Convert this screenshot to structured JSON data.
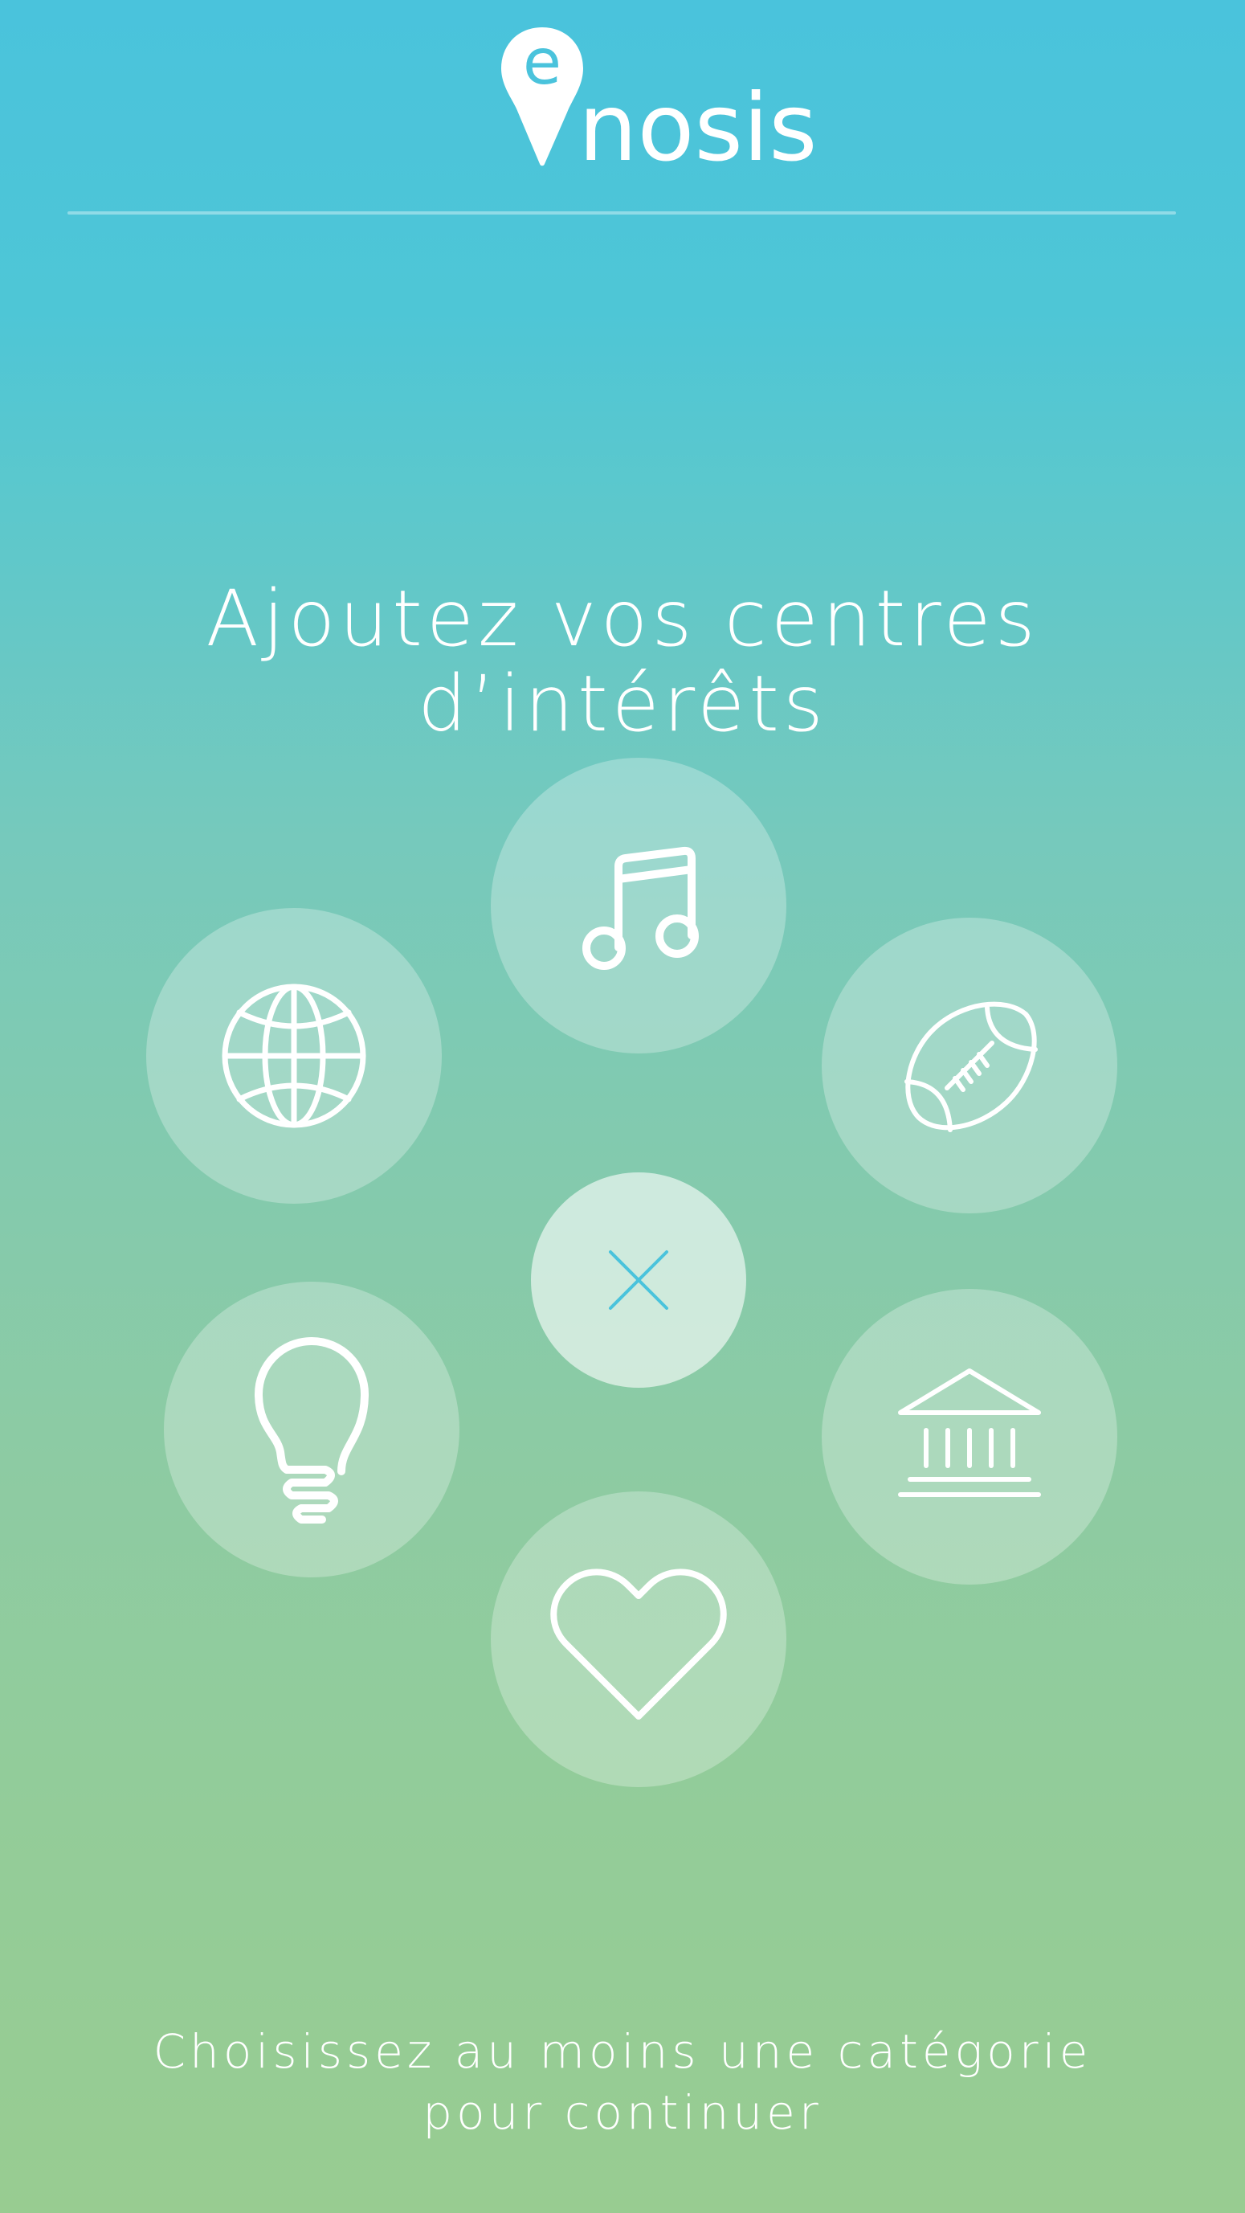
{
  "app": {
    "logo_text": "nosis",
    "logo_letter": "e"
  },
  "page": {
    "title": "Ajoutez vos centres d’intérêts",
    "footer_line1": "Choisissez au moins une catégorie",
    "footer_line2": "pour continuer"
  },
  "categories": [
    {
      "icon": "music-note-icon"
    },
    {
      "icon": "globe-icon"
    },
    {
      "icon": "rugby-ball-icon"
    },
    {
      "icon": "lightbulb-icon"
    },
    {
      "icon": "museum-icon"
    },
    {
      "icon": "heart-icon"
    }
  ],
  "close_icon": "close-icon",
  "colors": {
    "gradient_top": "#4AC3DC",
    "gradient_bottom": "#98CC91",
    "accent": "#4AC3DC",
    "foreground": "#FFFFFF"
  }
}
